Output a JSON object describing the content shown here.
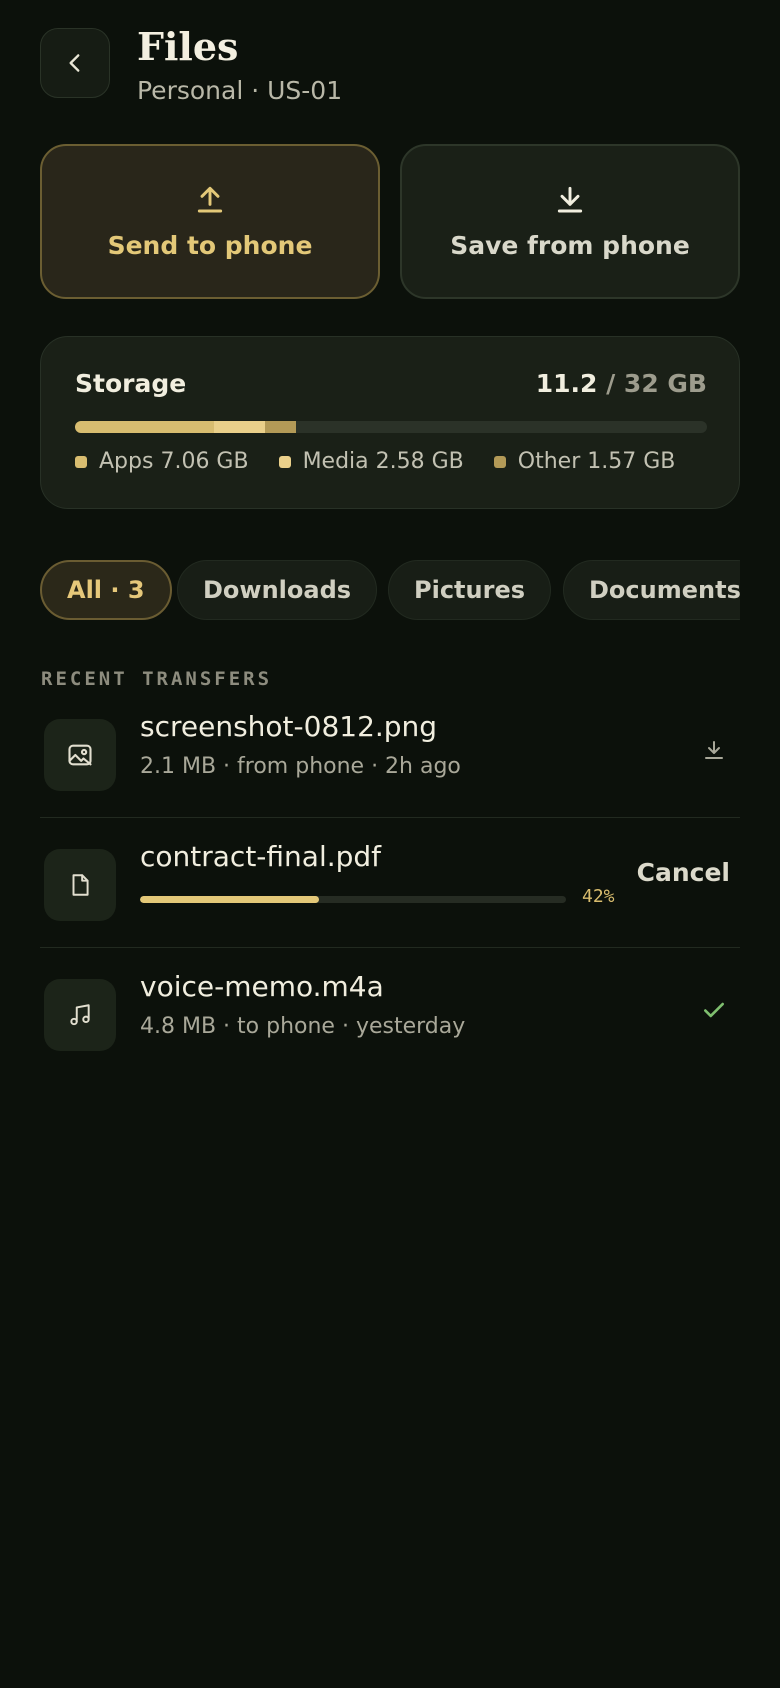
{
  "header": {
    "back_icon": "chevron-left-icon",
    "title": "Files",
    "subtitle": "Personal · US-01"
  },
  "actions": {
    "send": {
      "icon": "upload-icon",
      "label": "Send to phone"
    },
    "save": {
      "icon": "download-icon",
      "label": "Save from phone"
    }
  },
  "storage": {
    "title": "Storage",
    "used": "11.2",
    "separator": " / ",
    "total": "32 GB",
    "used_gb": 11.2,
    "total_gb": 32,
    "segments": [
      {
        "name": "Apps",
        "size_label": "7.06 GB",
        "value_gb": 7.06,
        "color": "#d8bd70"
      },
      {
        "name": "Media",
        "size_label": "2.58 GB",
        "value_gb": 2.58,
        "color": "#ead08a"
      },
      {
        "name": "Other",
        "size_label": "1.57 GB",
        "value_gb": 1.57,
        "color": "#b39a57"
      }
    ]
  },
  "filters": [
    {
      "label": "All · 3",
      "active": true
    },
    {
      "label": "Downloads",
      "active": false
    },
    {
      "label": "Pictures",
      "active": false
    },
    {
      "label": "Documents",
      "active": false
    }
  ],
  "section_title": "RECENT TRANSFERS",
  "transfers": [
    {
      "name": "screenshot-0812.png",
      "meta": "2.1 MB · from phone · 2h ago",
      "icon": "image-icon",
      "status_icon": "download-icon"
    },
    {
      "name": "contract-final.pdf",
      "icon": "document-icon",
      "progress": 0.42,
      "progress_label": "42%",
      "cancel_label": "Cancel"
    },
    {
      "name": "voice-memo.m4a",
      "meta": "4.8 MB · to phone · yesterday",
      "icon": "music-note-icon",
      "status_icon": "check-icon"
    }
  ],
  "colors": {
    "background": "#0c110b",
    "accent": "#e3c878",
    "success": "#7fbf6f"
  }
}
